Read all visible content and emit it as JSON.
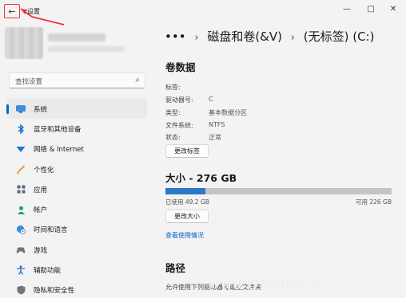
{
  "app": {
    "title": "设置"
  },
  "window_controls": {
    "minimize": "—",
    "maximize": "□",
    "close": "✕"
  },
  "search": {
    "placeholder": "查找设置"
  },
  "nav": {
    "items": [
      {
        "label": "系统",
        "icon": "system-icon",
        "selected": true
      },
      {
        "label": "蓝牙和其他设备",
        "icon": "bluetooth-icon"
      },
      {
        "label": "网络 & Internet",
        "icon": "network-icon"
      },
      {
        "label": "个性化",
        "icon": "brush-icon"
      },
      {
        "label": "应用",
        "icon": "apps-icon"
      },
      {
        "label": "帐户",
        "icon": "account-icon"
      },
      {
        "label": "时间和语言",
        "icon": "globe-clock-icon"
      },
      {
        "label": "游戏",
        "icon": "gaming-icon"
      },
      {
        "label": "辅助功能",
        "icon": "accessibility-icon"
      },
      {
        "label": "隐私和安全性",
        "icon": "shield-icon"
      }
    ]
  },
  "breadcrumb": {
    "ellipsis": "•••",
    "sep": "›",
    "parent": "磁盘和卷(&V)",
    "current": "(无标签) (C:)"
  },
  "volume": {
    "title": "卷数据",
    "label_key": "标签:",
    "label_val": "",
    "drive_key": "驱动器号:",
    "drive_val": "C",
    "type_key": "类型:",
    "type_val": "基本数据分区",
    "fs_key": "文件系统:",
    "fs_val": "NTFS",
    "status_key": "状态:",
    "status_val": "正常",
    "change_label_btn": "更改标签"
  },
  "size": {
    "title": "大小 - 276 GB",
    "used_fraction": 0.178,
    "used_text": "已使用 49.2 GB",
    "avail_text": "可用 226 GB",
    "change_size_btn": "更改大小",
    "usage_link": "查看使用情况"
  },
  "path": {
    "title": "路径",
    "desc": "允许使用下列驱动器号或空文件夹"
  },
  "watermark": "www.i7admin.cc",
  "colors": {
    "accent": "#0067c0",
    "bar_fill": "#2b78c5",
    "bar_track": "#c4c4c4",
    "highlight": "#e53935"
  }
}
